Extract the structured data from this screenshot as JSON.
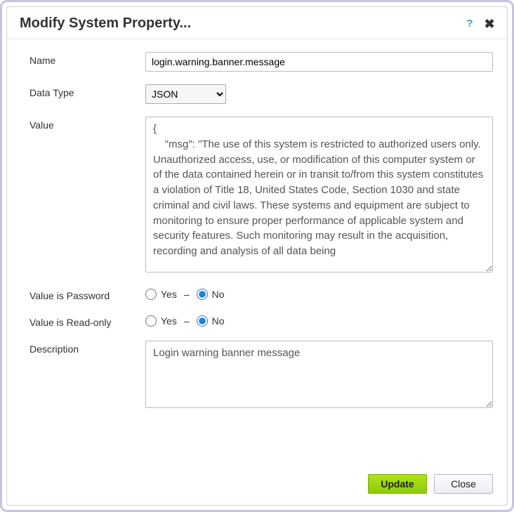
{
  "dialog": {
    "title": "Modify System Property..."
  },
  "form": {
    "name": {
      "label": "Name",
      "value": "login.warning.banner.message"
    },
    "dataType": {
      "label": "Data Type",
      "value": "JSON",
      "options": [
        "JSON"
      ]
    },
    "value": {
      "label": "Value",
      "value": "{\n    \"msg\": \"The use of this system is restricted to authorized users only. Unauthorized access, use, or modification of this computer system or of the data contained herein or in transit to/from this system constitutes a violation of Title 18, United States Code, Section 1030 and state criminal and civil laws. These systems and equipment are subject to monitoring to ensure proper performance of applicable system and security features. Such monitoring may result in the acquisition, recording and analysis of all data being"
    },
    "isPassword": {
      "label": "Value is Password",
      "yes": "Yes",
      "no": "No",
      "selected": "no"
    },
    "isReadonly": {
      "label": "Value is Read-only",
      "yes": "Yes",
      "no": "No",
      "selected": "no"
    },
    "description": {
      "label": "Description",
      "value": "Login warning banner message"
    }
  },
  "buttons": {
    "update": "Update",
    "close": "Close"
  }
}
